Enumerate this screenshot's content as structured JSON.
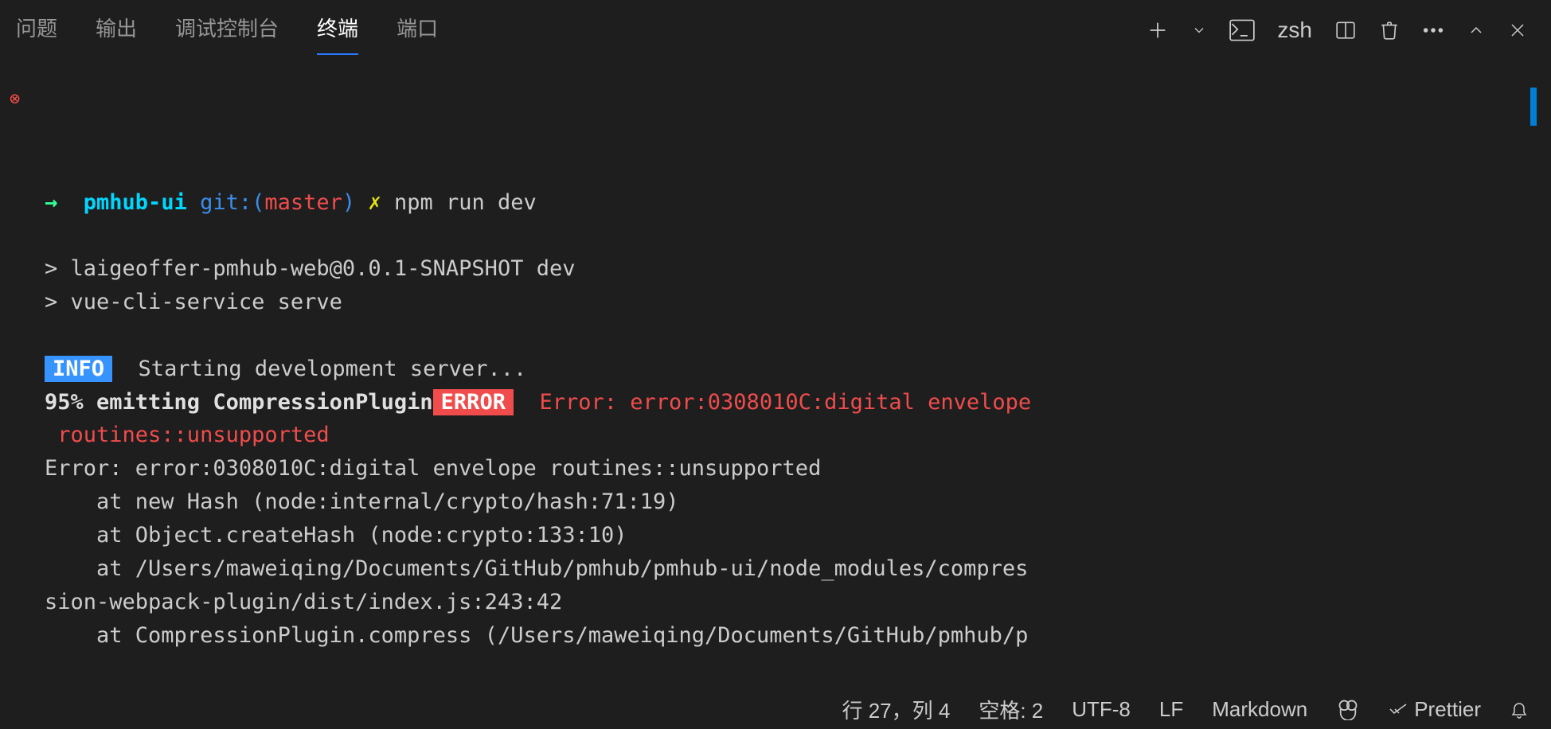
{
  "tabs": {
    "problems": "问题",
    "output": "输出",
    "debug": "调试控制台",
    "terminal": "终端",
    "ports": "端口"
  },
  "toolbar": {
    "shell": "zsh"
  },
  "prompt": {
    "arrow": "→",
    "project": "pmhub-ui",
    "git_label": "git:(",
    "branch": "master",
    "git_close": ")",
    "dirty": "✗",
    "command": "npm run dev"
  },
  "output": {
    "line1": "> laigeoffer-pmhub-web@0.0.1-SNAPSHOT dev",
    "line2": "> vue-cli-service serve",
    "info_label": "INFO",
    "info_text": " Starting development server...",
    "emit": "95% emitting CompressionPlugin",
    "error_label": "ERROR",
    "error_head": " Error: error:0308010C:digital envelope",
    "error_cont": " routines::unsupported",
    "trace1": "Error: error:0308010C:digital envelope routines::unsupported",
    "trace2": "    at new Hash (node:internal/crypto/hash:71:19)",
    "trace3": "    at Object.createHash (node:crypto:133:10)",
    "trace4": "    at /Users/maweiqing/Documents/GitHub/pmhub/pmhub-ui/node_modules/compres",
    "trace4b": "sion-webpack-plugin/dist/index.js:243:42",
    "trace5": "    at CompressionPlugin.compress (/Users/maweiqing/Documents/GitHub/pmhub/p"
  },
  "status": {
    "line_col": "行 27，列 4",
    "spaces": "空格: 2",
    "encoding": "UTF-8",
    "eol": "LF",
    "language": "Markdown",
    "formatter": "Prettier"
  }
}
